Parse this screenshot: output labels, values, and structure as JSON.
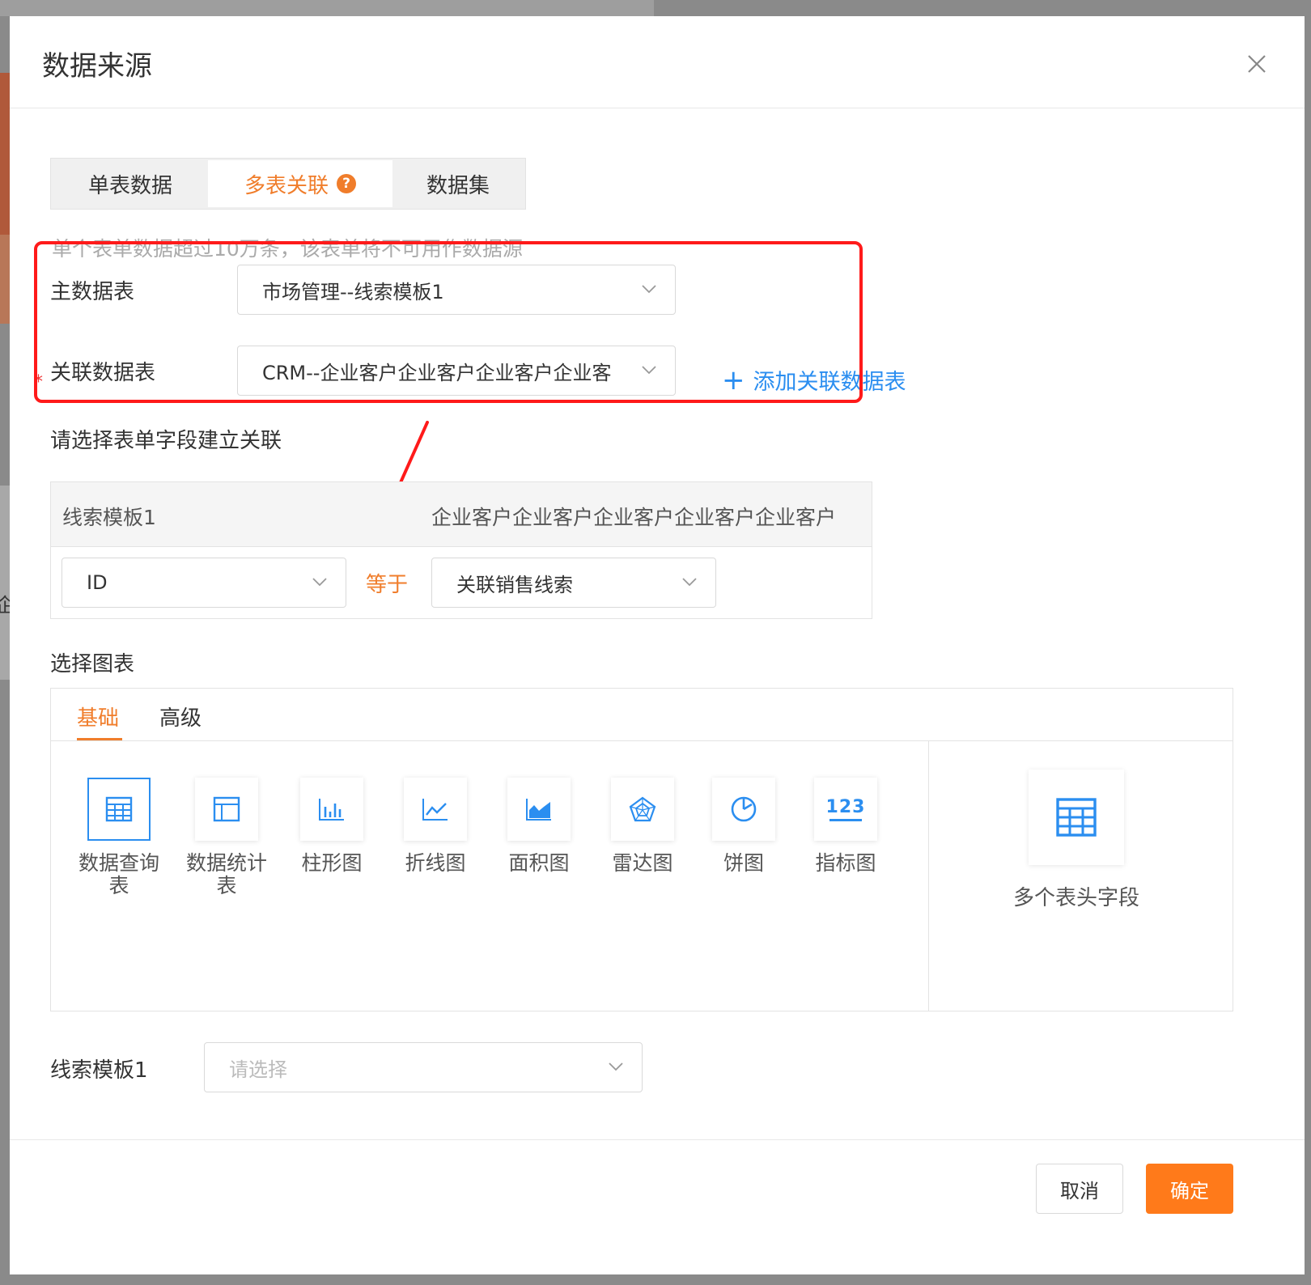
{
  "background": {
    "fragment_char": "企"
  },
  "modal": {
    "title": "数据来源",
    "segments": [
      {
        "label": "单表数据"
      },
      {
        "label": "多表关联",
        "help": "?"
      },
      {
        "label": "数据集"
      }
    ],
    "notice": "单个表单数据超过10万条，该表单将不可用作数据源",
    "main_table": {
      "label": "主数据表",
      "value": "市场管理--线索模板1"
    },
    "related_table": {
      "required_mark": "*",
      "label": "关联数据表",
      "value": "CRM--企业客户企业客户企业客户企业客"
    },
    "add_related": {
      "plus": "+",
      "label": "添加关联数据表"
    },
    "relation": {
      "title": "请选择表单字段建立关联",
      "left_header": "线索模板1",
      "right_header": "企业客户企业客户企业客户企业客户企业客户",
      "left_field": "ID",
      "operator": "等于",
      "right_field": "关联销售线索"
    },
    "chart_section": {
      "title": "选择图表",
      "tabs": [
        "基础",
        "高级"
      ],
      "items": [
        {
          "label": "数据查询表",
          "icon": "grid-table-icon"
        },
        {
          "label": "数据统计表",
          "icon": "stat-table-icon"
        },
        {
          "label": "柱形图",
          "icon": "bar-chart-icon"
        },
        {
          "label": "折线图",
          "icon": "line-chart-icon"
        },
        {
          "label": "面积图",
          "icon": "area-chart-icon"
        },
        {
          "label": "雷达图",
          "icon": "radar-chart-icon"
        },
        {
          "label": "饼图",
          "icon": "pie-chart-icon"
        },
        {
          "label": "指标图",
          "icon": "kpi-icon",
          "glyph": "123"
        }
      ],
      "multi_header": {
        "label": "多个表头字段",
        "icon": "multi-header-table-icon"
      }
    },
    "field_select": {
      "label": "线索模板1",
      "placeholder": "请选择"
    },
    "footer": {
      "cancel": "取消",
      "ok": "确定"
    },
    "colors": {
      "accent": "#f07d2b",
      "link": "#2b8ef0",
      "primary_button": "#ff7a1a",
      "annotation": "#ff1a1a"
    }
  }
}
